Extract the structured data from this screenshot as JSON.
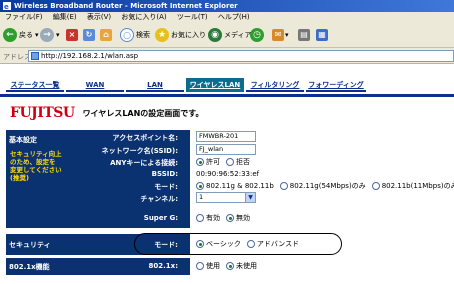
{
  "window": {
    "title": "Wireless Broadband Router - Microsoft Internet Explorer"
  },
  "menu": [
    "ファイル(F)",
    "編集(E)",
    "表示(V)",
    "お気に入り(A)",
    "ツール(T)",
    "ヘルプ(H)"
  ],
  "toolbar": {
    "back": "戻る",
    "search": "検索",
    "favorites": "お気に入り",
    "media": "メディア"
  },
  "address": {
    "label": "アドレス(D)",
    "url": "http://192.168.2.1/wlan.asp"
  },
  "nav": {
    "tabs": [
      "ステータス一覧",
      "WAN",
      "LAN",
      "ワイヤレスLAN",
      "フィルタリング",
      "フォワーディング"
    ],
    "active": 3
  },
  "brand": {
    "logo": "FUJITSU",
    "page_title": "ワイヤレスLANの設定画面です。"
  },
  "basic": {
    "section": "基本設定",
    "warning": [
      "セキュリティ向上",
      "のため、設定を",
      "変更してください",
      "(推奨)"
    ],
    "ap_name_label": "アクセスポイント名:",
    "ap_name": "FMWBR-201",
    "ssid_label": "ネットワーク名(SSID):",
    "ssid": "FJ_wlan",
    "any_label": "ANYキーによる接続:",
    "any_allow": "許可",
    "any_deny": "拒否",
    "bssid_label": "BSSID:",
    "bssid": "00:90:96:52:33:ef",
    "mode_label": "モード:",
    "mode_opts": [
      "802.11g & 802.11b",
      "802.11g(54Mbps)のみ",
      "802.11b(11Mbps)のみ"
    ],
    "channel_label": "チャンネル:",
    "channel": "1",
    "superg_label": "Super G:",
    "superg_on": "有効",
    "superg_off": "無効"
  },
  "security": {
    "section": "セキュリティ",
    "mode_label": "モード:",
    "basic": "ベーシック",
    "advanced": "アドバンスド"
  },
  "auth": {
    "section": "802.1x機能",
    "label": "802.1x:",
    "use": "使用",
    "nouse": "未使用"
  }
}
